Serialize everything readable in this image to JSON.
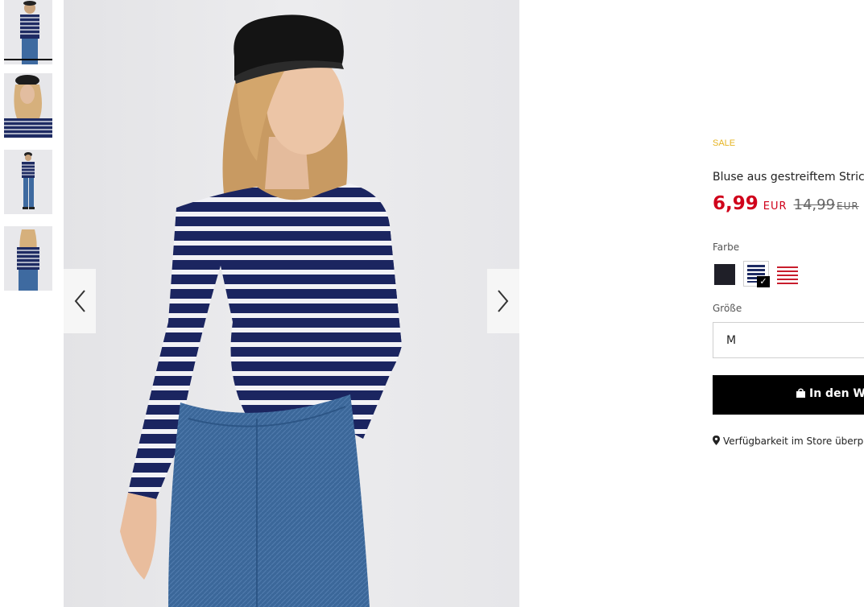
{
  "gallery": {
    "thumbnails": [
      "thumb-front",
      "thumb-portrait",
      "thumb-full-body",
      "thumb-back"
    ],
    "prev_icon": "chevron-left-icon",
    "next_icon": "chevron-right-icon"
  },
  "product": {
    "badge": "SALE",
    "title": "Bluse aus gestreiftem Stric",
    "price": "6,99",
    "currency": "EUR",
    "old_price": "14,99",
    "old_currency": "EUR",
    "colors": {
      "accent_sale": "#e6b422",
      "price": "#d0021b"
    }
  },
  "color_picker": {
    "label": "Farbe",
    "options": [
      "black",
      "navy-white-stripes",
      "white-red-stripes"
    ],
    "selected": "navy-white-stripes"
  },
  "size_picker": {
    "label": "Größe",
    "selected": "M"
  },
  "actions": {
    "cart_label": "In den W",
    "cart_icon": "shopping-bag-icon",
    "store_label": "Verfügbarkeit im Store überp",
    "store_icon": "map-pin-icon"
  }
}
